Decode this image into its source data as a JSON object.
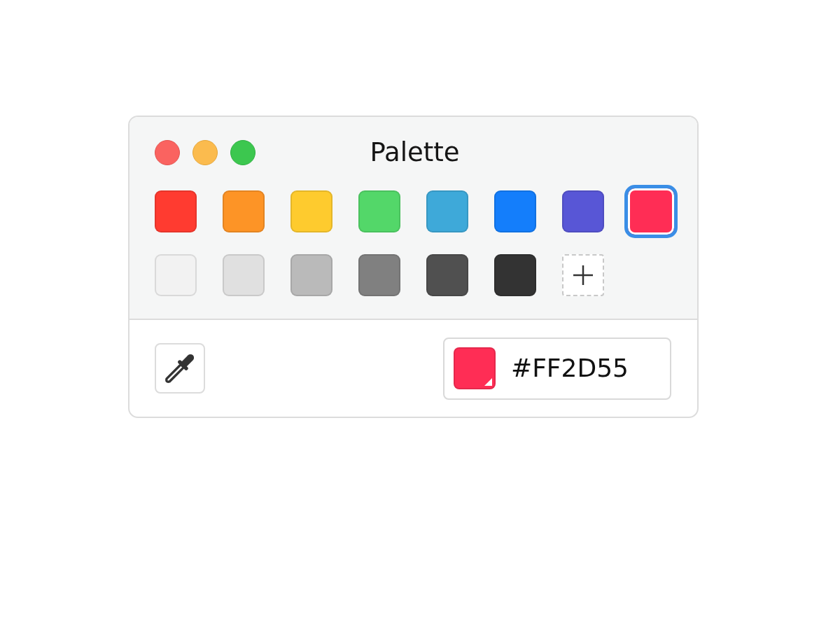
{
  "window": {
    "title": "Palette"
  },
  "swatch_rows": [
    {
      "swatches": [
        {
          "color": "#ff3b30",
          "selected": false
        },
        {
          "color": "#fd9426",
          "selected": false
        },
        {
          "color": "#fecb2e",
          "selected": false
        },
        {
          "color": "#53d769",
          "selected": false
        },
        {
          "color": "#3ea9d9",
          "selected": false
        },
        {
          "color": "#147efb",
          "selected": false
        },
        {
          "color": "#5856d6",
          "selected": false
        },
        {
          "color": "#ff2d55",
          "selected": true
        }
      ]
    },
    {
      "swatches": [
        {
          "color": "#f2f2f2",
          "selected": false
        },
        {
          "color": "#e0e0e0",
          "selected": false
        },
        {
          "color": "#bababa",
          "selected": false
        },
        {
          "color": "#808080",
          "selected": false
        },
        {
          "color": "#505050",
          "selected": false
        },
        {
          "color": "#333333",
          "selected": false
        }
      ]
    }
  ],
  "hex_field": {
    "color": "#ff2d55",
    "value": "#FF2D55"
  }
}
